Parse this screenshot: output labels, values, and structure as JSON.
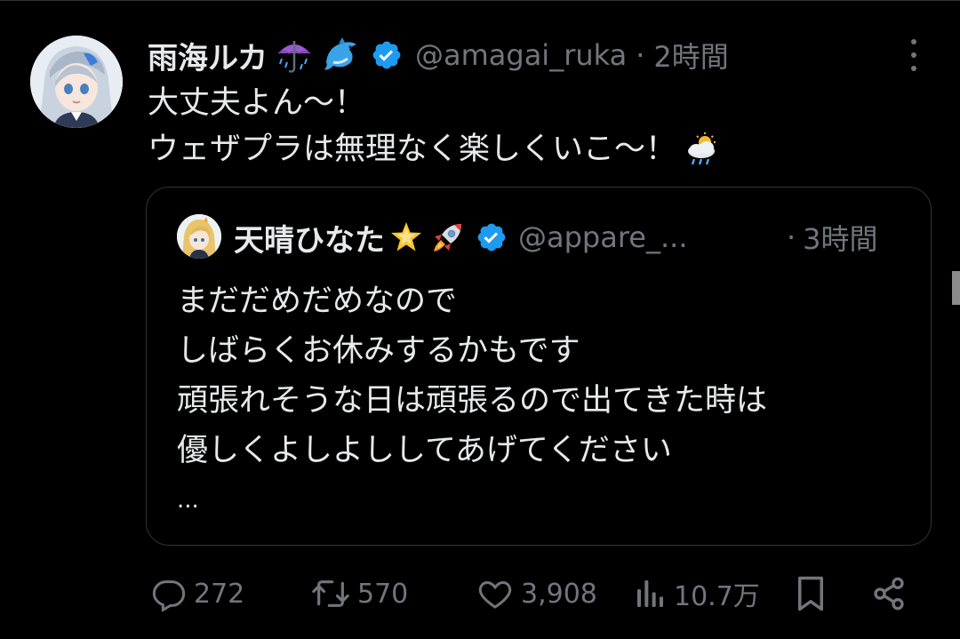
{
  "tweet": {
    "author": {
      "display_name": "雨海ルカ",
      "name_emojis": [
        "umbrella-with-rain",
        "dolphin"
      ],
      "handle": "@amagai_ruka",
      "verified": true
    },
    "separator": "·",
    "time": "2時間",
    "text_lines": [
      "大丈夫よん〜！",
      "ウェザプラは無理なく楽しくいこ〜！"
    ],
    "trailing_emoji": "sun-behind-rain-cloud"
  },
  "quoted": {
    "author": {
      "display_name": "天晴ひなた",
      "name_emojis": [
        "glowing-star",
        "rocket"
      ],
      "handle": "@appare_...",
      "verified": true
    },
    "separator": "·",
    "time": "3時間",
    "text_lines": [
      "まだだめだめなので",
      "しばらくお休みするかもです",
      "頑張れそうな日は頑張るので出てきた時は",
      "優しくよしよししてあげてください",
      "..."
    ]
  },
  "actions": {
    "reply_count": "272",
    "retweet_count": "570",
    "like_count": "3,908",
    "view_count": "10.7万"
  },
  "colors": {
    "background": "#000000",
    "primary_text": "#e7e9ea",
    "secondary_text": "#71767b",
    "verified_blue": "#1d9bf0",
    "border": "#2f3336"
  }
}
